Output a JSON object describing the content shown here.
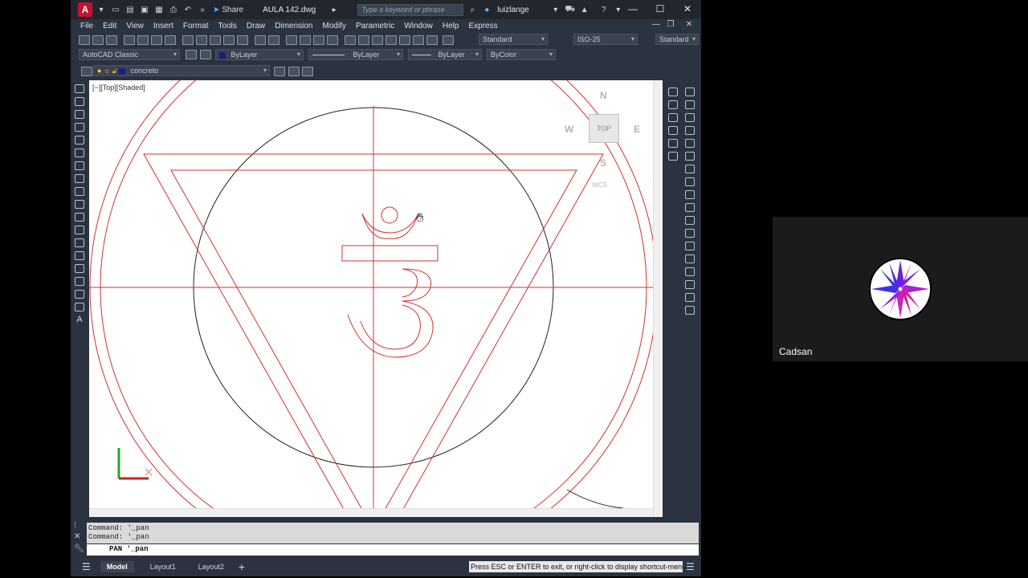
{
  "window": {
    "document_title": "AULA 142.dwg",
    "share_label": "Share",
    "search_placeholder": "Type a keyword or phrase",
    "user_name": "luizlange"
  },
  "menu": [
    "File",
    "Edit",
    "View",
    "Insert",
    "Format",
    "Tools",
    "Draw",
    "Dimension",
    "Modify",
    "Parametric",
    "Window",
    "Help",
    "Express"
  ],
  "toolbar": {
    "text_style": "Standard",
    "dim_style": "ISO-25",
    "table_style": "Standard",
    "workspace": "AutoCAD Classic",
    "color": "ByLayer",
    "linetype": "ByLayer",
    "lineweight": "ByLayer",
    "plotstyle": "ByColor",
    "layer": "concreto"
  },
  "viewport": {
    "label": "[−][Top][Shaded]",
    "viewcube_face": "TOP",
    "north": "N",
    "south": "S",
    "east": "E",
    "west": "W",
    "wcs": "WCS"
  },
  "command": {
    "history": [
      "Command: '_pan",
      "Command: '_pan"
    ],
    "current": "PAN '_pan"
  },
  "status": {
    "tabs": [
      "Model",
      "Layout1",
      "Layout2"
    ],
    "message": "Press ESC or ENTER to exit, or right-click to display shortcut-menu."
  },
  "participant": {
    "name": "Cadsan"
  },
  "colors": {
    "drawing_red": "#d03030",
    "drawing_black": "#222222",
    "ui_dark": "#2b3240"
  }
}
